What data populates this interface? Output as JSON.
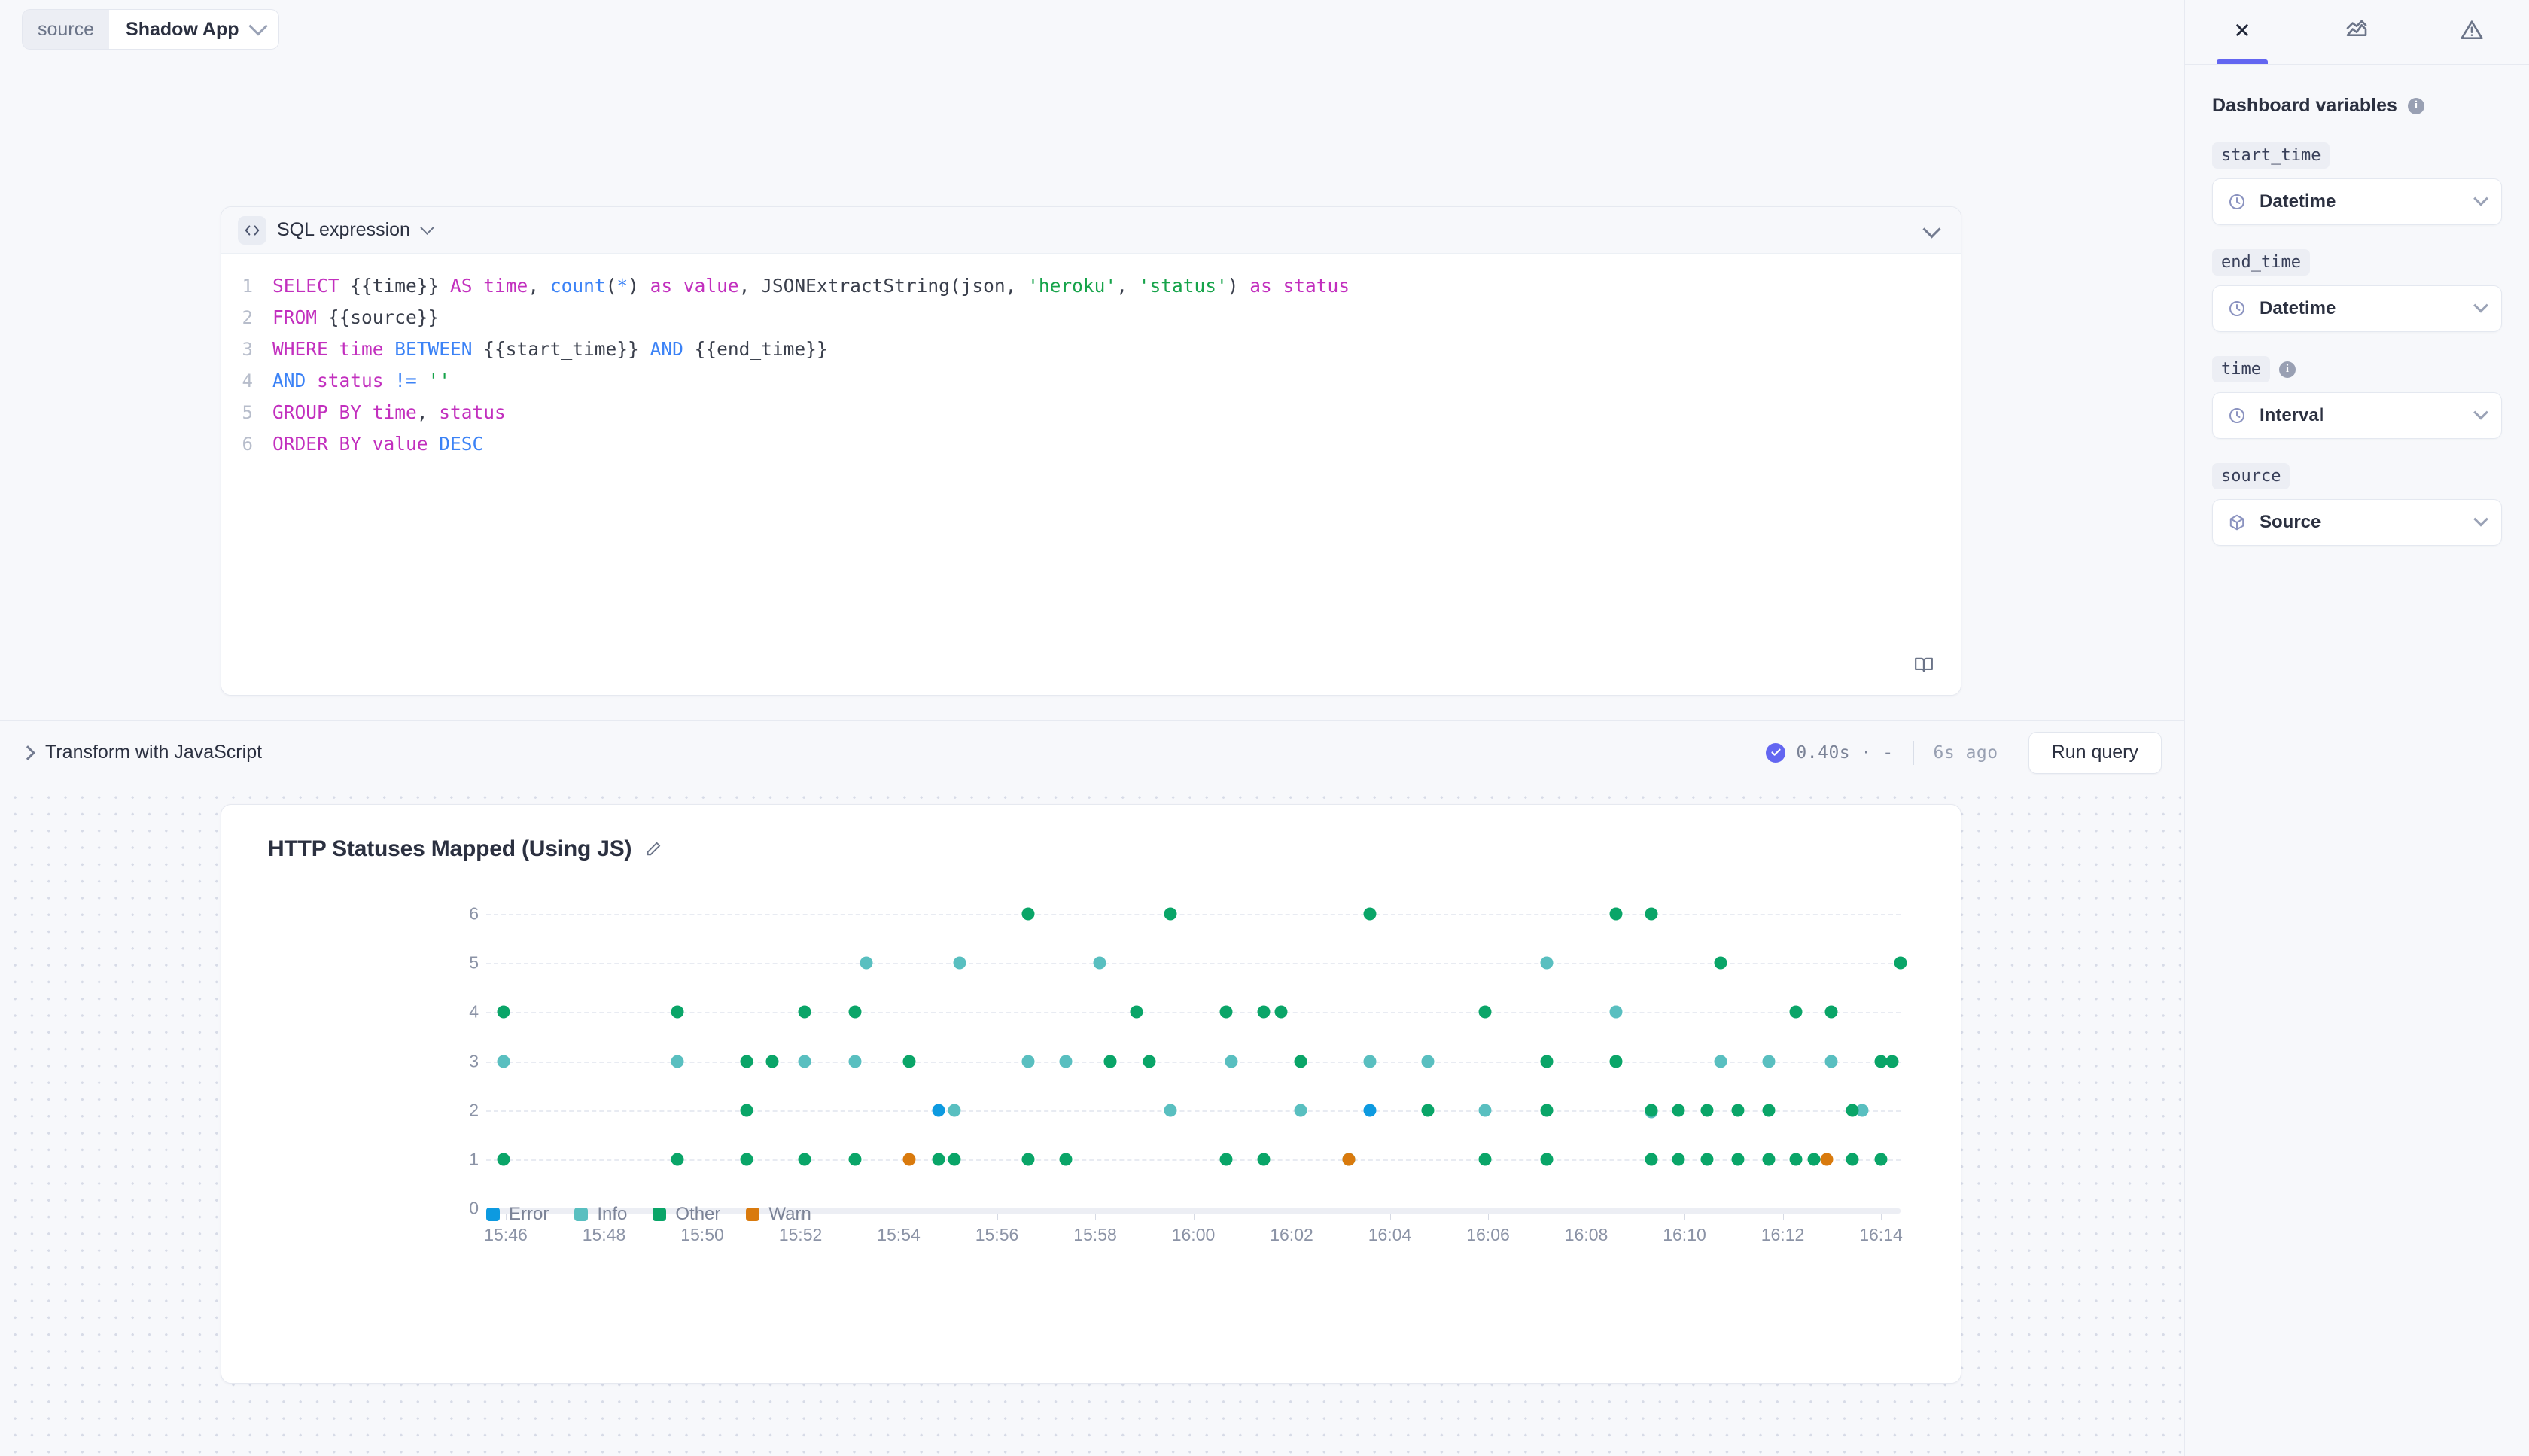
{
  "topbar": {
    "source_key": "source",
    "source_value": "Shadow App",
    "chevron_icon": "chevron-down-icon"
  },
  "editor": {
    "badge_icon": "code-brackets-icon",
    "title": "SQL expression",
    "title_chevron_icon": "chevron-down-icon",
    "collapse_icon": "chevron-down-icon",
    "docs_icon": "book-icon",
    "lines": [
      {
        "n": "1",
        "tokens": [
          {
            "t": "SELECT ",
            "c": "kw"
          },
          {
            "t": "{{time}}",
            "c": "mut"
          },
          {
            "t": " AS ",
            "c": "kw"
          },
          {
            "t": "time",
            "c": "kw"
          },
          {
            "t": ", ",
            "c": "mut"
          },
          {
            "t": "count",
            "c": "kw2"
          },
          {
            "t": "(",
            "c": "mut"
          },
          {
            "t": "*",
            "c": "kw2"
          },
          {
            "t": ") ",
            "c": "mut"
          },
          {
            "t": "as value",
            "c": "kw"
          },
          {
            "t": ", JSONExtractString(json, ",
            "c": "mut"
          },
          {
            "t": "'heroku'",
            "c": "str"
          },
          {
            "t": ", ",
            "c": "mut"
          },
          {
            "t": "'status'",
            "c": "str"
          },
          {
            "t": ") ",
            "c": "mut"
          },
          {
            "t": "as status",
            "c": "kw"
          }
        ]
      },
      {
        "n": "2",
        "tokens": [
          {
            "t": "FROM ",
            "c": "kw"
          },
          {
            "t": "{{source}}",
            "c": "mut"
          }
        ]
      },
      {
        "n": "3",
        "tokens": [
          {
            "t": "WHERE ",
            "c": "kw"
          },
          {
            "t": "time ",
            "c": "kw"
          },
          {
            "t": "BETWEEN ",
            "c": "kw2"
          },
          {
            "t": "{{start_time}} ",
            "c": "mut"
          },
          {
            "t": "AND ",
            "c": "kw2"
          },
          {
            "t": "{{end_time}}",
            "c": "mut"
          }
        ]
      },
      {
        "n": "4",
        "tokens": [
          {
            "t": "AND ",
            "c": "kw2"
          },
          {
            "t": "status ",
            "c": "kw"
          },
          {
            "t": "!= ",
            "c": "kw2"
          },
          {
            "t": "''",
            "c": "str"
          }
        ]
      },
      {
        "n": "5",
        "tokens": [
          {
            "t": "GROUP BY ",
            "c": "kw"
          },
          {
            "t": "time",
            "c": "kw"
          },
          {
            "t": ", ",
            "c": "mut"
          },
          {
            "t": "status",
            "c": "kw"
          }
        ]
      },
      {
        "n": "6",
        "tokens": [
          {
            "t": "ORDER BY ",
            "c": "kw"
          },
          {
            "t": "value ",
            "c": "kw"
          },
          {
            "t": "DESC",
            "c": "kw2"
          }
        ]
      }
    ]
  },
  "runbar": {
    "transform_label": "Transform with JavaScript",
    "transform_chevron_icon": "chevron-right-icon",
    "status_icon": "check-circle-icon",
    "duration": "0.40s · -",
    "ago": "6s ago",
    "run_label": "Run query",
    "status_color": "#6366f1"
  },
  "chart": {
    "title": "HTTP Statuses Mapped (Using JS)",
    "edit_icon": "pencil-icon"
  },
  "chart_data": {
    "type": "scatter",
    "title": "HTTP Statuses Mapped (Using JS)",
    "xlabel": "",
    "ylabel": "",
    "grid": true,
    "legend_position": "bottom-left",
    "yticks": [
      0,
      1,
      2,
      3,
      4,
      5,
      6
    ],
    "ylim": [
      0,
      6.6
    ],
    "xticks": [
      "15:46",
      "15:48",
      "15:50",
      "15:52",
      "15:54",
      "15:56",
      "15:58",
      "16:00",
      "16:02",
      "16:04",
      "16:06",
      "16:08",
      "16:10",
      "16:12",
      "16:14"
    ],
    "xlim": [
      0,
      100
    ],
    "legend": [
      {
        "name": "Error",
        "color": "#0d9ae0"
      },
      {
        "name": "Info",
        "color": "#59bfc0"
      },
      {
        "name": "Other",
        "color": "#0aa568"
      },
      {
        "name": "Warn",
        "color": "#d97a0d"
      }
    ],
    "series": [
      {
        "name": "Error",
        "color": "#0d9ae0",
        "points": [
          [
            32.0,
            2
          ],
          [
            62.5,
            2
          ]
        ]
      },
      {
        "name": "Info",
        "color": "#59bfc0",
        "points": [
          [
            1.2,
            3
          ],
          [
            13.5,
            3
          ],
          [
            22.5,
            3
          ],
          [
            26.1,
            3
          ],
          [
            33.1,
            2
          ],
          [
            38.3,
            3
          ],
          [
            41.0,
            3
          ],
          [
            44.1,
            3
          ],
          [
            26.9,
            5
          ],
          [
            33.5,
            5
          ],
          [
            43.4,
            5
          ],
          [
            48.4,
            2
          ],
          [
            52.7,
            3
          ],
          [
            57.6,
            2
          ],
          [
            62.5,
            3
          ],
          [
            70.6,
            2
          ],
          [
            75.0,
            5
          ],
          [
            79.9,
            4
          ],
          [
            82.4,
            1.97
          ],
          [
            87.3,
            3
          ],
          [
            90.7,
            3
          ],
          [
            95.1,
            3
          ],
          [
            97.3,
            2
          ],
          [
            66.6,
            3
          ]
        ]
      },
      {
        "name": "Other",
        "color": "#0aa568",
        "points": [
          [
            1.2,
            4
          ],
          [
            1.2,
            1
          ],
          [
            13.5,
            4
          ],
          [
            18.4,
            3
          ],
          [
            20.2,
            3
          ],
          [
            18.4,
            2
          ],
          [
            13.5,
            1
          ],
          [
            18.4,
            1
          ],
          [
            22.5,
            4
          ],
          [
            26.1,
            4
          ],
          [
            22.5,
            1
          ],
          [
            26.1,
            1
          ],
          [
            29.9,
            3
          ],
          [
            32.0,
            1
          ],
          [
            33.1,
            1
          ],
          [
            38.3,
            6
          ],
          [
            38.3,
            1
          ],
          [
            41.0,
            1
          ],
          [
            44.1,
            3
          ],
          [
            46.0,
            4
          ],
          [
            46.9,
            3
          ],
          [
            48.4,
            6
          ],
          [
            52.3,
            4
          ],
          [
            55.0,
            4
          ],
          [
            56.2,
            4
          ],
          [
            52.3,
            1
          ],
          [
            55.0,
            1
          ],
          [
            57.6,
            3
          ],
          [
            61.0,
            1
          ],
          [
            66.6,
            2
          ],
          [
            62.5,
            6
          ],
          [
            70.6,
            4
          ],
          [
            70.6,
            1
          ],
          [
            75.0,
            3
          ],
          [
            75.0,
            2
          ],
          [
            75.0,
            1
          ],
          [
            79.9,
            6
          ],
          [
            79.9,
            3
          ],
          [
            82.4,
            6
          ],
          [
            82.4,
            2
          ],
          [
            84.3,
            2
          ],
          [
            86.3,
            2
          ],
          [
            88.5,
            2
          ],
          [
            90.7,
            2
          ],
          [
            82.4,
            1
          ],
          [
            84.3,
            1
          ],
          [
            86.3,
            1
          ],
          [
            88.5,
            1
          ],
          [
            90.7,
            1
          ],
          [
            92.6,
            1
          ],
          [
            96.6,
            1
          ],
          [
            98.6,
            1
          ],
          [
            87.3,
            5
          ],
          [
            92.6,
            4
          ],
          [
            95.1,
            4
          ],
          [
            93.9,
            1
          ],
          [
            96.6,
            2
          ],
          [
            98.6,
            3
          ],
          [
            100.0,
            5
          ],
          [
            99.4,
            3
          ]
        ]
      },
      {
        "name": "Warn",
        "color": "#d97a0d",
        "points": [
          [
            29.9,
            1
          ],
          [
            61.0,
            1
          ],
          [
            94.8,
            1
          ]
        ]
      }
    ]
  },
  "sidebar": {
    "tabs": [
      {
        "icon": "variable-x-icon",
        "active": true
      },
      {
        "icon": "chart-area-icon",
        "active": false
      },
      {
        "icon": "alert-triangle-icon",
        "active": false
      }
    ],
    "heading": "Dashboard variables",
    "heading_info_icon": "info-icon",
    "variables": [
      {
        "name": "start_time",
        "icon": "clock-icon",
        "value": "Datetime",
        "has_info": false,
        "chevron_icon": "chevron-down-icon"
      },
      {
        "name": "end_time",
        "icon": "clock-icon",
        "value": "Datetime",
        "has_info": false,
        "chevron_icon": "chevron-down-icon"
      },
      {
        "name": "time",
        "icon": "clock-icon",
        "value": "Interval",
        "has_info": true,
        "chevron_icon": "chevron-down-icon"
      },
      {
        "name": "source",
        "icon": "cube-icon",
        "value": "Source",
        "has_info": false,
        "chevron_icon": "chevron-down-icon"
      }
    ]
  }
}
